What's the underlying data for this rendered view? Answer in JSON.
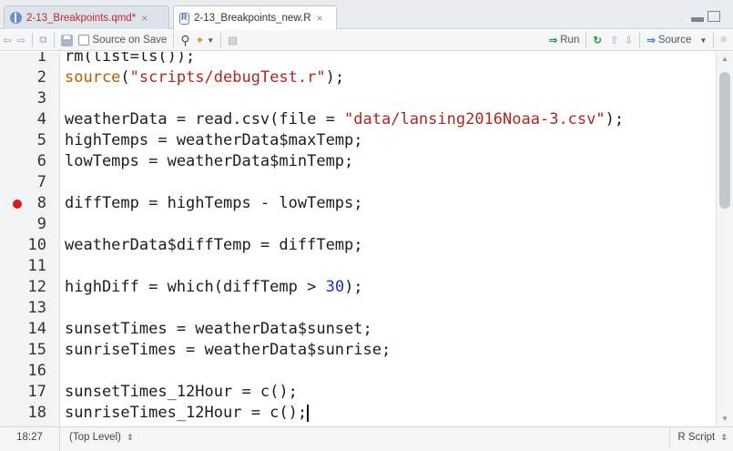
{
  "tabs": [
    {
      "label": "2-13_Breakpoints.qmd*",
      "icon": "quarto-file-icon",
      "active": false,
      "modified": true
    },
    {
      "label": "2-13_Breakpoints_new.R",
      "icon": "r-file-icon",
      "active": true,
      "modified": false
    }
  ],
  "toolbar": {
    "source_on_save": "Source on Save",
    "run": "Run",
    "source": "Source"
  },
  "editor": {
    "lines": [
      {
        "n": "1",
        "code": "rm(list=ls());"
      },
      {
        "n": "2",
        "code": "source(\"scripts/debugTest.r\");"
      },
      {
        "n": "3",
        "code": ""
      },
      {
        "n": "4",
        "code": "weatherData = read.csv(file = \"data/lansing2016Noaa-3.csv\");"
      },
      {
        "n": "5",
        "code": "highTemps = weatherData$maxTemp;"
      },
      {
        "n": "6",
        "code": "lowTemps = weatherData$minTemp;"
      },
      {
        "n": "7",
        "code": ""
      },
      {
        "n": "8",
        "code": "diffTemp = highTemps - lowTemps;",
        "breakpoint": true
      },
      {
        "n": "9",
        "code": ""
      },
      {
        "n": "10",
        "code": "weatherData$diffTemp = diffTemp;"
      },
      {
        "n": "11",
        "code": ""
      },
      {
        "n": "12",
        "code": "highDiff = which(diffTemp > 30);"
      },
      {
        "n": "13",
        "code": ""
      },
      {
        "n": "14",
        "code": "sunsetTimes = weatherData$sunset;"
      },
      {
        "n": "15",
        "code": "sunriseTimes = weatherData$sunrise;"
      },
      {
        "n": "16",
        "code": ""
      },
      {
        "n": "17",
        "code": "sunsetTimes_12Hour = c();"
      },
      {
        "n": "18",
        "code": "sunriseTimes_12Hour = c();"
      }
    ]
  },
  "status": {
    "position": "18:27",
    "scope": "(Top Level)",
    "file_type": "R Script"
  },
  "colors": {
    "string": "#b0261d",
    "keyword": "#b85b00",
    "number": "#1a2fd1",
    "breakpoint": "#d51b1b"
  }
}
